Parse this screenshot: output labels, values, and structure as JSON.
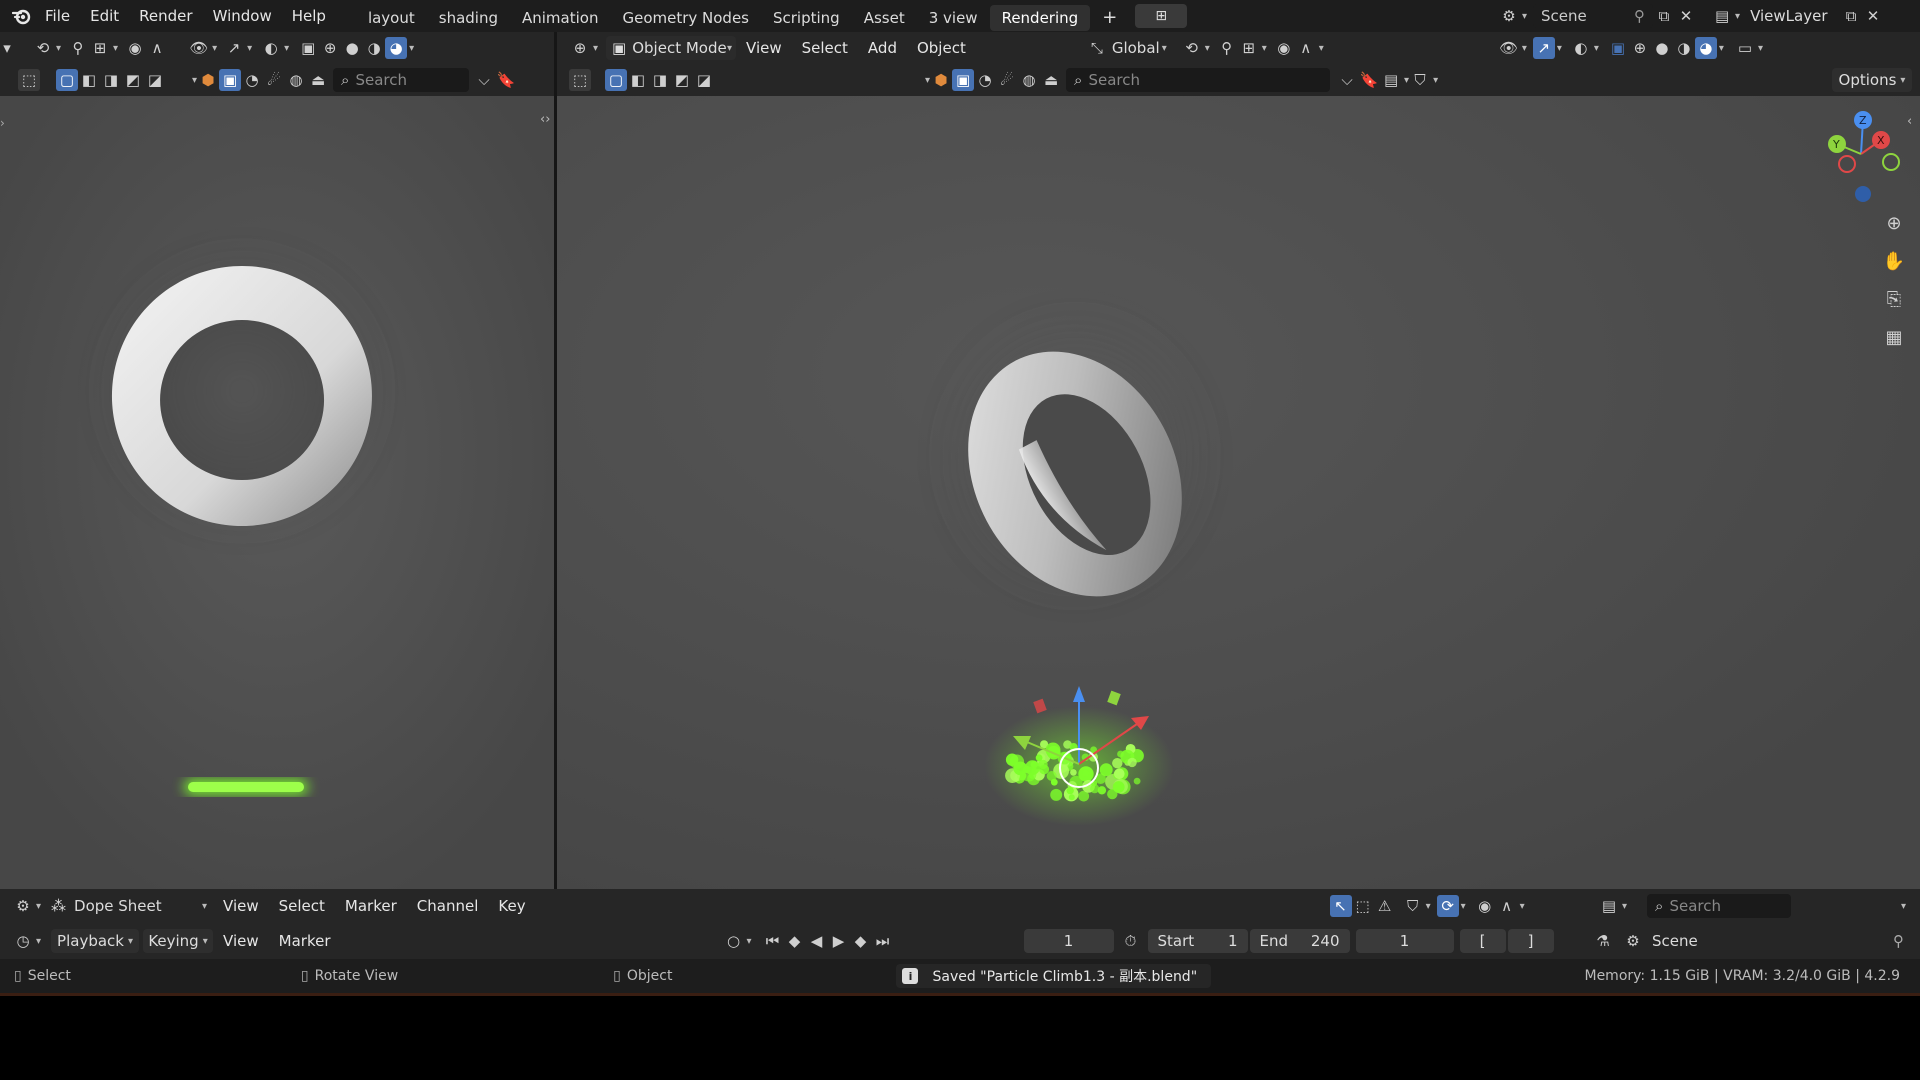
{
  "topbar": {
    "menus": [
      "File",
      "Edit",
      "Render",
      "Window",
      "Help"
    ],
    "workspaces": [
      "layout",
      "shading",
      "Animation",
      "Geometry Nodes",
      "Scripting",
      "Asset",
      "3 view",
      "Rendering"
    ],
    "active_workspace": "Rendering",
    "add_tab": "+",
    "scene_label": "Scene",
    "viewlayer_label": "ViewLayer"
  },
  "left_view": {
    "search_placeholder": "Search"
  },
  "right_view": {
    "mode": "Object Mode",
    "menus": [
      "View",
      "Select",
      "Add",
      "Object"
    ],
    "orientation": "Global",
    "search_placeholder": "Search",
    "options_label": "Options",
    "gizmo_axes": {
      "x": "X",
      "y": "Y",
      "z": "Z"
    }
  },
  "dopesheet": {
    "editor": "Dope Sheet",
    "menus": [
      "View",
      "Select",
      "Marker",
      "Channel",
      "Key"
    ],
    "search_placeholder": "Search"
  },
  "timeline": {
    "playback": "Playback",
    "keying": "Keying",
    "view": "View",
    "marker": "Marker",
    "current_frame": "1",
    "start_label": "Start",
    "start_value": "1",
    "end_label": "End",
    "end_value": "240",
    "frame_field": "1",
    "outliner_scene": "Scene"
  },
  "statusbar": {
    "select": "Select",
    "rotate": "Rotate View",
    "object": "Object",
    "message": "Saved \"Particle Climb1.3 - 副本.blend\"",
    "memory": "Memory: 1.15 GiB | VRAM: 3.2/4.0 GiB | 4.2.9"
  },
  "colors": {
    "accent": "#4772b3",
    "particles": "#7dff2a",
    "viewport_bg": "#4b4b4b"
  }
}
